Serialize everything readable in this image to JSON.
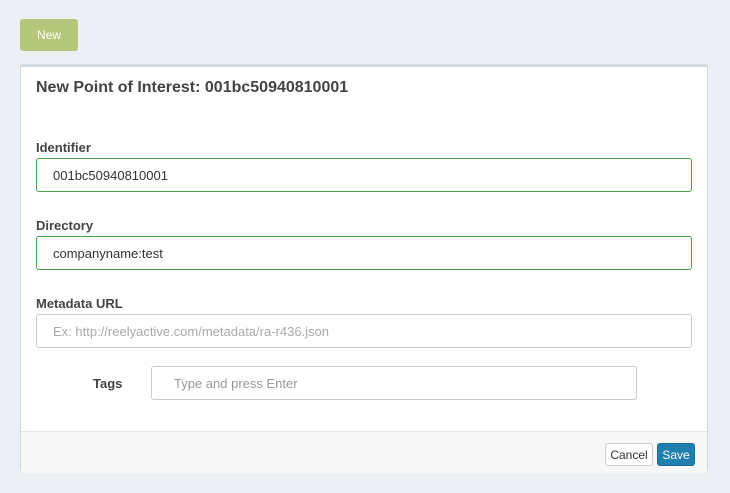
{
  "toolbar": {
    "new_label": "New"
  },
  "panel": {
    "title": "New Point of Interest: 001bc50940810001",
    "identifier": {
      "label": "Identifier",
      "value": "001bc50940810001"
    },
    "directory": {
      "label": "Directory",
      "value": "companyname:test"
    },
    "metadata_url": {
      "label": "Metadata URL",
      "value": "",
      "placeholder": "Ex: http://reelyactive.com/metadata/ra-r436.json"
    },
    "tags": {
      "label": "Tags",
      "value": "",
      "placeholder": "Type and press Enter"
    }
  },
  "footer": {
    "cancel_label": "Cancel",
    "save_label": "Save"
  },
  "colors": {
    "page_bg": "#ecf0f5",
    "new_button": "#b5c77a",
    "valid_border": "#4aa14a",
    "save_button": "#1f7fae"
  }
}
